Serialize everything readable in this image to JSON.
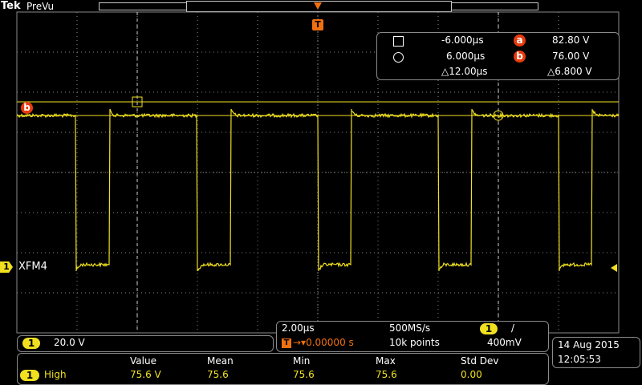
{
  "header": {
    "brand": "Tek",
    "mode": "PreVu"
  },
  "cursor_readout": {
    "cursor_a_time": "-6.000µs",
    "cursor_a_label": "a",
    "cursor_a_value": "82.80 V",
    "cursor_b_time": "6.000µs",
    "cursor_b_label": "b",
    "cursor_b_value": "76.00 V",
    "delta_time": "△12.00µs",
    "delta_value": "△6.800 V"
  },
  "trigger": {
    "marker": "T",
    "position_readout": "0.00000 s",
    "level": "400mV",
    "slope_symbol": "/",
    "source": "1"
  },
  "channel1": {
    "number": "1",
    "label": "XFM4",
    "scale": "20.0 V",
    "cursor_b_marker": "b",
    "color": "#f0e020"
  },
  "timebase": {
    "scale": "2.00µs",
    "sample_rate": "500MS/s",
    "record_length": "10k points"
  },
  "datetime": {
    "date": "14 Aug   2015",
    "time": "12:05:53"
  },
  "measurements": {
    "headers": [
      "Value",
      "Mean",
      "Min",
      "Max",
      "Std Dev"
    ],
    "rows": [
      {
        "channel": "1",
        "name": "High",
        "value": "75.6 V",
        "mean": "75.6",
        "min": "75.6",
        "max": "75.6",
        "std_dev": "0.00"
      }
    ]
  },
  "colors": {
    "trace": "#f0e020",
    "cursor_badge": "#e83a0c",
    "trigger_marker": "#f07010",
    "grid": "#8a8a8a"
  }
}
